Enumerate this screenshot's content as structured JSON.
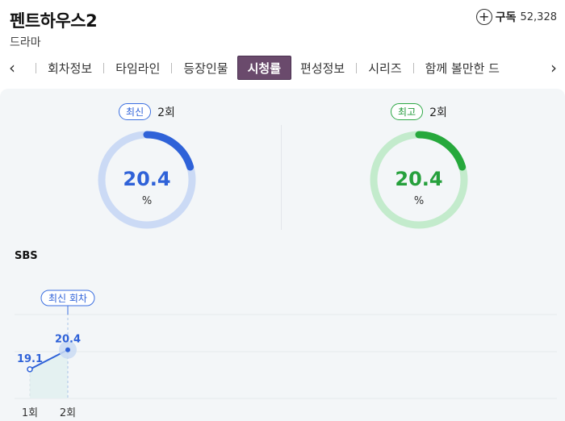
{
  "header": {
    "title": "펜트하우스2",
    "genre": "드라마",
    "subscribe_label": "구독",
    "subscribe_count": "52,328"
  },
  "tabs": [
    {
      "label": "회차정보",
      "active": false
    },
    {
      "label": "타임라인",
      "active": false
    },
    {
      "label": "등장인물",
      "active": false
    },
    {
      "label": "시청률",
      "active": true
    },
    {
      "label": "편성정보",
      "active": false
    },
    {
      "label": "시리즈",
      "active": false
    },
    {
      "label": "함께 볼만한 드",
      "active": false
    }
  ],
  "gauges": {
    "latest": {
      "badge": "최신",
      "episode": "2회",
      "value": "20.4",
      "unit": "%",
      "fraction": 0.204,
      "color": "#2f62d8",
      "track": "#cbdaf5"
    },
    "best": {
      "badge": "최고",
      "episode": "2회",
      "value": "20.4",
      "unit": "%",
      "fraction": 0.204,
      "color": "#26a83c",
      "track": "#c3ebcc"
    }
  },
  "network": "SBS",
  "chart_data": {
    "type": "line",
    "categories": [
      "1회",
      "2회"
    ],
    "series": [
      {
        "values": [
          19.1,
          20.4
        ]
      }
    ],
    "value_labels": [
      "19.1",
      "20.4"
    ],
    "highlight": {
      "index": 1,
      "label": "최신 회차"
    },
    "color": "#2f62d8"
  }
}
